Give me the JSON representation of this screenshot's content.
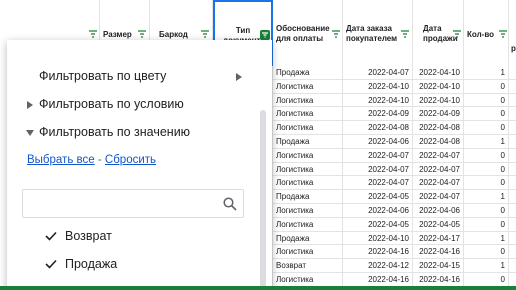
{
  "headers": [
    {
      "label": "Размер"
    },
    {
      "label": "Баркод"
    },
    {
      "label": "Тип документа"
    },
    {
      "label": "Обоснование для оплаты"
    },
    {
      "label": "Дата заказа покупателем"
    },
    {
      "label": "Дата продажи"
    },
    {
      "label": "Кол-во"
    },
    {
      "label": "р"
    }
  ],
  "rows": [
    {
      "reason": "Продажа",
      "order": "2022-04-07",
      "sale": "2022-04-10",
      "qty": "1"
    },
    {
      "reason": "Логистика",
      "order": "2022-04-10",
      "sale": "2022-04-10",
      "qty": "0"
    },
    {
      "reason": "Логистика",
      "order": "2022-04-10",
      "sale": "2022-04-10",
      "qty": "0"
    },
    {
      "reason": "Логистика",
      "order": "2022-04-09",
      "sale": "2022-04-09",
      "qty": "0"
    },
    {
      "reason": "Логистика",
      "order": "2022-04-08",
      "sale": "2022-04-08",
      "qty": "0"
    },
    {
      "reason": "Продажа",
      "order": "2022-04-06",
      "sale": "2022-04-08",
      "qty": "1"
    },
    {
      "reason": "Логистика",
      "order": "2022-04-07",
      "sale": "2022-04-07",
      "qty": "0"
    },
    {
      "reason": "Логистика",
      "order": "2022-04-07",
      "sale": "2022-04-07",
      "qty": "0"
    },
    {
      "reason": "Логистика",
      "order": "2022-04-07",
      "sale": "2022-04-07",
      "qty": "0"
    },
    {
      "reason": "Продажа",
      "order": "2022-04-05",
      "sale": "2022-04-07",
      "qty": "1"
    },
    {
      "reason": "Логистика",
      "order": "2022-04-06",
      "sale": "2022-04-06",
      "qty": "0"
    },
    {
      "reason": "Логистика",
      "order": "2022-04-05",
      "sale": "2022-04-05",
      "qty": "0"
    },
    {
      "reason": "Продажа",
      "order": "2022-04-10",
      "sale": "2022-04-17",
      "qty": "1"
    },
    {
      "reason": "Логистика",
      "order": "2022-04-16",
      "sale": "2022-04-16",
      "qty": "0"
    },
    {
      "reason": "Возврат",
      "order": "2022-04-12",
      "sale": "2022-04-15",
      "qty": "1"
    },
    {
      "reason": "Логистика",
      "order": "2022-04-16",
      "sale": "2022-04-16",
      "qty": "0"
    }
  ],
  "filter_panel": {
    "by_color": "Фильтровать по цвету",
    "by_condition": "Фильтровать по условию",
    "by_value": "Фильтровать по значению",
    "select_all": "Выбрать все",
    "separator": "-",
    "reset": "Сбросить",
    "search_placeholder": "",
    "values": [
      {
        "label": "Возврат",
        "checked": true
      },
      {
        "label": "Продажа",
        "checked": true
      }
    ]
  },
  "colors": {
    "accent": "#1a73e8",
    "filter_green": "#188038",
    "link": "#1155cc"
  }
}
